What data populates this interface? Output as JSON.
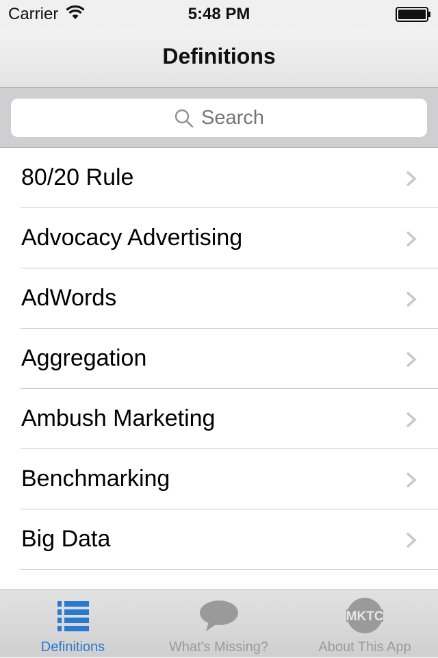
{
  "status_bar": {
    "carrier": "Carrier",
    "time": "5:48 PM"
  },
  "nav": {
    "title": "Definitions"
  },
  "search": {
    "placeholder": "Search"
  },
  "list": {
    "items": [
      {
        "label": "80/20 Rule"
      },
      {
        "label": "Advocacy Advertising"
      },
      {
        "label": "AdWords"
      },
      {
        "label": "Aggregation"
      },
      {
        "label": "Ambush Marketing"
      },
      {
        "label": "Benchmarking"
      },
      {
        "label": "Big Data"
      },
      {
        "label": ""
      }
    ]
  },
  "tab_bar": {
    "tabs": [
      {
        "label": "Definitions",
        "icon": "list-icon",
        "active": true
      },
      {
        "label": "What's Missing?",
        "icon": "speech-bubble-icon",
        "active": false
      },
      {
        "label": "About This App",
        "icon": "mktc-logo-icon",
        "active": false
      }
    ]
  },
  "colors": {
    "accent": "#2a79cf",
    "inactive_tab": "#9a9a9a",
    "search_background": "#cfcfd2",
    "divider": "#c8c7cc"
  }
}
